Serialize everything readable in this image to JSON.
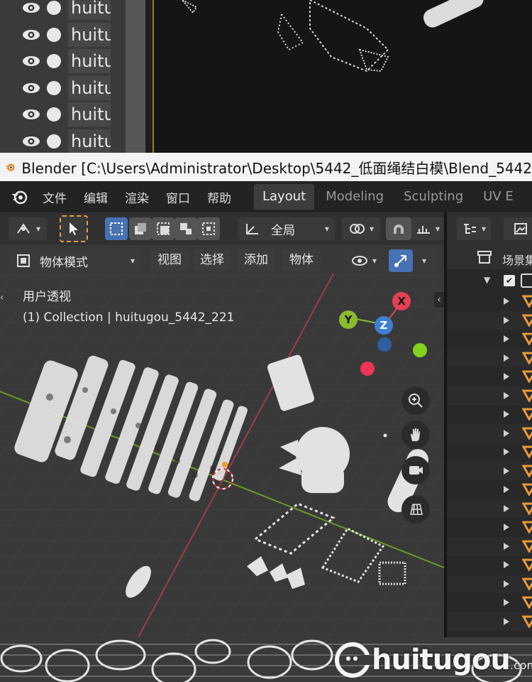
{
  "top_strip": {
    "outliner_rows": [
      "huitu",
      "huitu",
      "huitu",
      "huitu",
      "huitu",
      "huitu"
    ]
  },
  "window": {
    "title": "Blender [C:\\Users\\Administrator\\Desktop\\5442_低面绳结白模\\Blend_5442"
  },
  "menu": {
    "items": [
      "文件",
      "编辑",
      "渲染",
      "窗口",
      "帮助"
    ],
    "workspace_tabs": [
      "Layout",
      "Modeling",
      "Sculpting",
      "UV E"
    ],
    "active_tab": "Layout"
  },
  "viewport": {
    "header": {
      "transform_orientation": "全局",
      "interaction_mode": "物体模式",
      "menus": [
        "视图",
        "选择",
        "添加",
        "物体"
      ]
    },
    "view_name": "用户透视",
    "collection_info": "(1) Collection | huitugou_5442_221",
    "gizmo": {
      "x_label": "X",
      "y_label": "Y",
      "z_label": "Z",
      "x_color": "#e64052",
      "y_color": "#8bba2e",
      "z_color": "#3e7fd6"
    },
    "nav_icons": [
      "zoom-icon",
      "hand-pan-icon",
      "camera-icon",
      "grid-ortho-icon"
    ]
  },
  "outliner": {
    "scene_label": "场景集",
    "object_rows": 18
  },
  "watermark": {
    "brand": "huitugou",
    "suffix": ".com"
  }
}
